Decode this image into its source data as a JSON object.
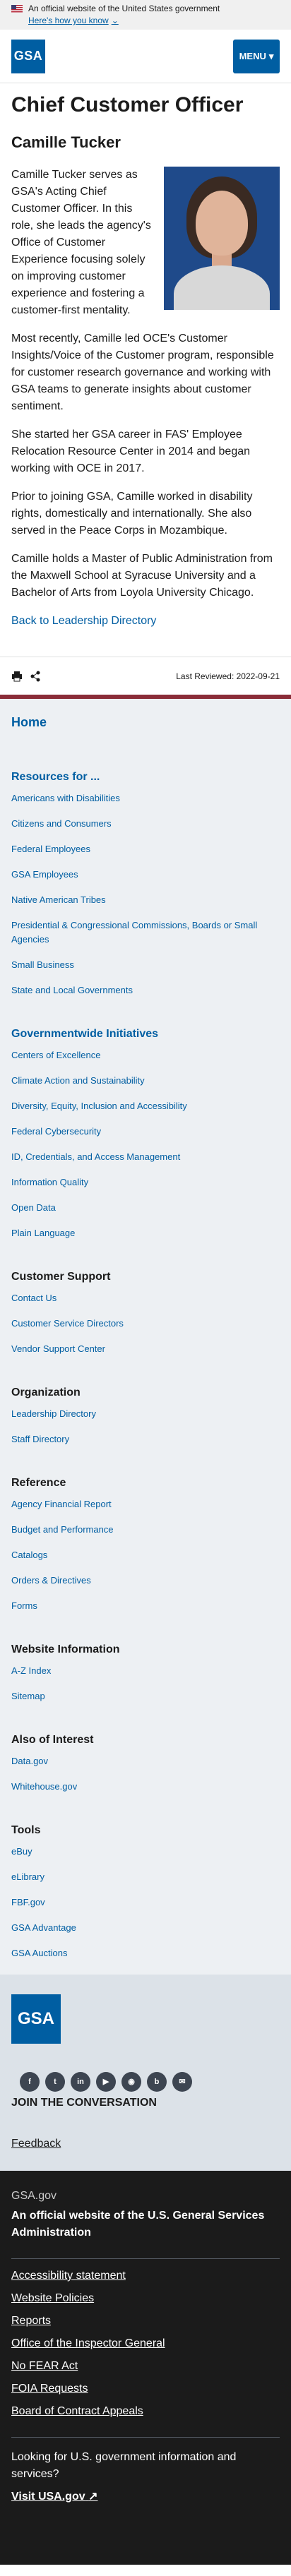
{
  "banner": {
    "text": "An official website of the United States government",
    "how_link": "Here's how you know"
  },
  "header": {
    "logo": "GSA",
    "menu_label": "MENU"
  },
  "page": {
    "title": "Chief Customer Officer",
    "name": "Camille Tucker",
    "paragraphs": [
      "Camille Tucker serves as GSA's Acting Chief Customer Officer. In this role, she leads the agency's Office of Customer Experience focusing solely on improving customer experience and fostering a customer-first mentality.",
      "Most recently, Camille led OCE's Customer Insights/Voice of the Customer program, responsible for customer research governance and working with GSA teams to generate insights about customer sentiment.",
      "She started her GSA career in FAS' Employee Relocation Resource Center in 2014 and began working with OCE in 2017.",
      "Prior to joining GSA, Camille worked in disability rights, domestically and internationally. She also served in the Peace Corps in Mozambique.",
      "Camille holds a Master of Public Administration from the Maxwell School at Syracuse University and a Bachelor of Arts from Loyola University Chicago."
    ],
    "back_link": "Back to Leadership Directory",
    "last_reviewed": "Last Reviewed: 2022-09-21"
  },
  "footer_nav": {
    "home": "Home",
    "sections": [
      {
        "title": "Resources for ...",
        "items": [
          "Americans with Disabilities",
          "Citizens and Consumers",
          "Federal Employees",
          "GSA Employees",
          "Native American Tribes",
          "Presidential & Congressional Commissions, Boards or Small Agencies",
          "Small Business",
          "State and Local Governments"
        ]
      },
      {
        "title": "Governmentwide Initiatives",
        "items": [
          "Centers of Excellence",
          "Climate Action and Sustainability",
          "Diversity, Equity, Inclusion and Accessibility",
          "Federal Cybersecurity",
          "ID, Credentials, and Access Management",
          "Information Quality",
          "Open Data",
          "Plain Language"
        ]
      },
      {
        "title": "Customer Support",
        "items": [
          "Contact Us",
          "Customer Service Directors",
          "Vendor Support Center"
        ]
      },
      {
        "title": "Organization",
        "items": [
          "Leadership Directory",
          "Staff Directory"
        ]
      },
      {
        "title": "Reference",
        "items": [
          "Agency Financial Report",
          "Budget and Performance",
          "Catalogs",
          "Orders & Directives",
          "Forms"
        ]
      },
      {
        "title": "Website Information",
        "items": [
          "A-Z Index",
          "Sitemap"
        ]
      },
      {
        "title": "Also of Interest",
        "items": [
          "Data.gov",
          "Whitehouse.gov"
        ]
      },
      {
        "title": "Tools",
        "items": [
          "eBuy",
          "eLibrary",
          "FBF.gov",
          "GSA Advantage",
          "GSA Auctions"
        ]
      }
    ]
  },
  "footer_brand": {
    "logo": "GSA",
    "social": [
      "facebook-icon",
      "twitter-icon",
      "linkedin-icon",
      "youtube-icon",
      "instagram-icon",
      "blog-icon",
      "email-icon"
    ],
    "join": "JOIN THE CONVERSATION",
    "feedback": "Feedback"
  },
  "identifier": {
    "domain": "GSA.gov",
    "official": "An official website of the U.S. General Services Administration",
    "links": [
      "Accessibility statement",
      "Website Policies",
      "Reports",
      "Office of the Inspector General",
      "No FEAR Act",
      "FOIA Requests",
      "Board of Contract Appeals"
    ],
    "looking": "Looking for U.S. government information and services?",
    "visit": "Visit USA.gov"
  },
  "colors": {
    "primary": "#005ea2",
    "accent": "#8a2c38",
    "footer_bg": "#edf0f3",
    "identifier_bg": "#1b1b1b"
  }
}
